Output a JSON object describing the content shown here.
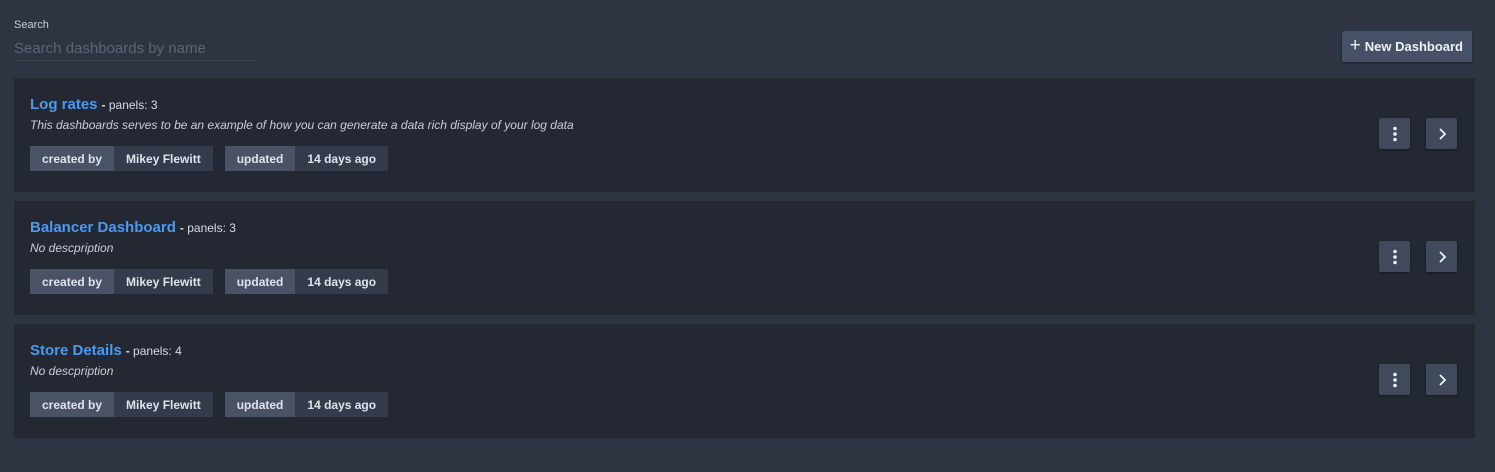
{
  "search": {
    "label": "Search",
    "placeholder": "Search dashboards by name",
    "value": ""
  },
  "new_dashboard_button": {
    "label": "New Dashboard",
    "icon": "plus-icon"
  },
  "dashboards": [
    {
      "title": "Log rates",
      "separator": "-",
      "panels_label": "panels:",
      "panels_count": "3",
      "description": "This dashboards serves to be an example of how you can generate a data rich display of your log data",
      "created_by_label": "created by",
      "created_by": "Mikey Flewitt",
      "updated_label": "updated",
      "updated": "14 days ago"
    },
    {
      "title": "Balancer Dashboard",
      "separator": "-",
      "panels_label": "panels:",
      "panels_count": "3",
      "description": "No descpription",
      "created_by_label": "created by",
      "created_by": "Mikey Flewitt",
      "updated_label": "updated",
      "updated": "14 days ago"
    },
    {
      "title": "Store Details",
      "separator": "-",
      "panels_label": "panels:",
      "panels_count": "4",
      "description": "No descpription",
      "created_by_label": "created by",
      "created_by": "Mikey Flewitt",
      "updated_label": "updated",
      "updated": "14 days ago"
    }
  ],
  "icons": {
    "menu": "more-vertical-icon",
    "open": "chevron-right-icon"
  },
  "colors": {
    "background": "#2f3443",
    "card": "#242833",
    "link": "#4a9af0",
    "button": "#465067",
    "tag_key": "#4a5266",
    "tag_value": "#353b4a"
  }
}
